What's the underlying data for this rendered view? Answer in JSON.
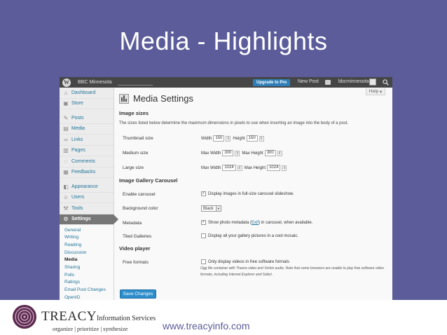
{
  "slide": {
    "title": "Media - Highlights",
    "url": "www.treacyinfo.com",
    "logo": {
      "name_big": "TREACY",
      "name_small": "Information Services",
      "tagline": "organize | prioritize | synthesize"
    }
  },
  "adminbar": {
    "site_name": "BBC Minnesota",
    "upgrade": "Upgrade to Pro",
    "new_post": "New Post",
    "username": "bbcminnesota"
  },
  "help": "Help",
  "sidebar": {
    "items": [
      {
        "label": "Dashboard",
        "icon": "dashboard-icon"
      },
      {
        "label": "Store",
        "icon": "store-icon"
      },
      {
        "label": "Posts",
        "icon": "pin-icon"
      },
      {
        "label": "Media",
        "icon": "media-icon"
      },
      {
        "label": "Links",
        "icon": "links-icon"
      },
      {
        "label": "Pages",
        "icon": "pages-icon"
      },
      {
        "label": "Comments",
        "icon": "comments-icon"
      },
      {
        "label": "Feedbacks",
        "icon": "feedback-icon"
      },
      {
        "label": "Appearance",
        "icon": "appearance-icon"
      },
      {
        "label": "Users",
        "icon": "users-icon"
      },
      {
        "label": "Tools",
        "icon": "tools-icon"
      },
      {
        "label": "Settings",
        "icon": "settings-icon"
      }
    ],
    "submenu": [
      "General",
      "Writing",
      "Reading",
      "Discussion",
      "Media",
      "Sharing",
      "Polls",
      "Ratings",
      "Email Post Changes",
      "OpenID"
    ]
  },
  "page": {
    "title": "Media Settings",
    "image_sizes": {
      "heading": "Image sizes",
      "description": "The sizes listed below determine the maximum dimensions in pixels to use when inserting an image into the body of a post.",
      "thumbnail": {
        "label": "Thumbnail size",
        "width_label": "Width",
        "width": "150",
        "height_label": "Height",
        "height": "150"
      },
      "medium": {
        "label": "Medium size",
        "width_label": "Max Width",
        "width": "300",
        "height_label": "Max Height",
        "height": "300"
      },
      "large": {
        "label": "Large size",
        "width_label": "Max Width",
        "width": "1024",
        "height_label": "Max Height",
        "height": "1024"
      }
    },
    "carousel": {
      "heading": "Image Gallery Carousel",
      "enable_label": "Enable carousel",
      "enable_text": "Display images in full-size carousel slideshow.",
      "enable_checked": true,
      "bg_label": "Background color",
      "bg_value": "Black",
      "metadata_label": "Metadata",
      "metadata_text_before": "Show photo metadata (",
      "metadata_link": "Exif",
      "metadata_text_after": ") in carousel, when available.",
      "metadata_checked": true,
      "tiled_label": "Tiled Galleries",
      "tiled_text": "Display all your gallery pictures in a cool mosaic.",
      "tiled_checked": false
    },
    "video": {
      "heading": "Video player",
      "free_label": "Free formats",
      "free_text": "Only display videos in free software formats",
      "free_checked": false,
      "note": "Ogg file container with Theora video and Vorbis audio. Note that some browsers are unable to play free software video formats, including Internet Explorer and Safari."
    },
    "save_button": "Save Changes"
  },
  "colors": {
    "slide_bg": "#5b5c99",
    "adminbar": "#464646",
    "link": "#21759b",
    "button": "#2e8ecb"
  }
}
